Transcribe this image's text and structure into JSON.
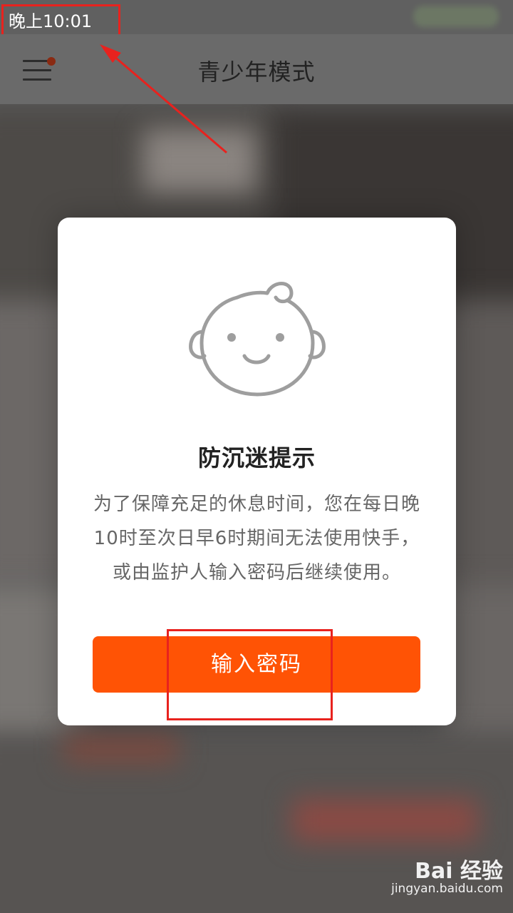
{
  "status_bar": {
    "time": "晚上10:01"
  },
  "header": {
    "title": "青少年模式",
    "menu_icon": "menu-icon"
  },
  "dialog": {
    "icon": "baby-face-icon",
    "title": "防沉迷提示",
    "message": "为了保障充足的休息时间，您在每日晚10时至次日早6时期间无法使用快手，或由监护人输入密码后继续使用。",
    "button_label": "输入密码"
  },
  "watermark": {
    "logo": "Bai 经验",
    "url": "jingyan.baidu.com"
  },
  "colors": {
    "accent": "#ff5305",
    "annotation": "#e8221e"
  }
}
